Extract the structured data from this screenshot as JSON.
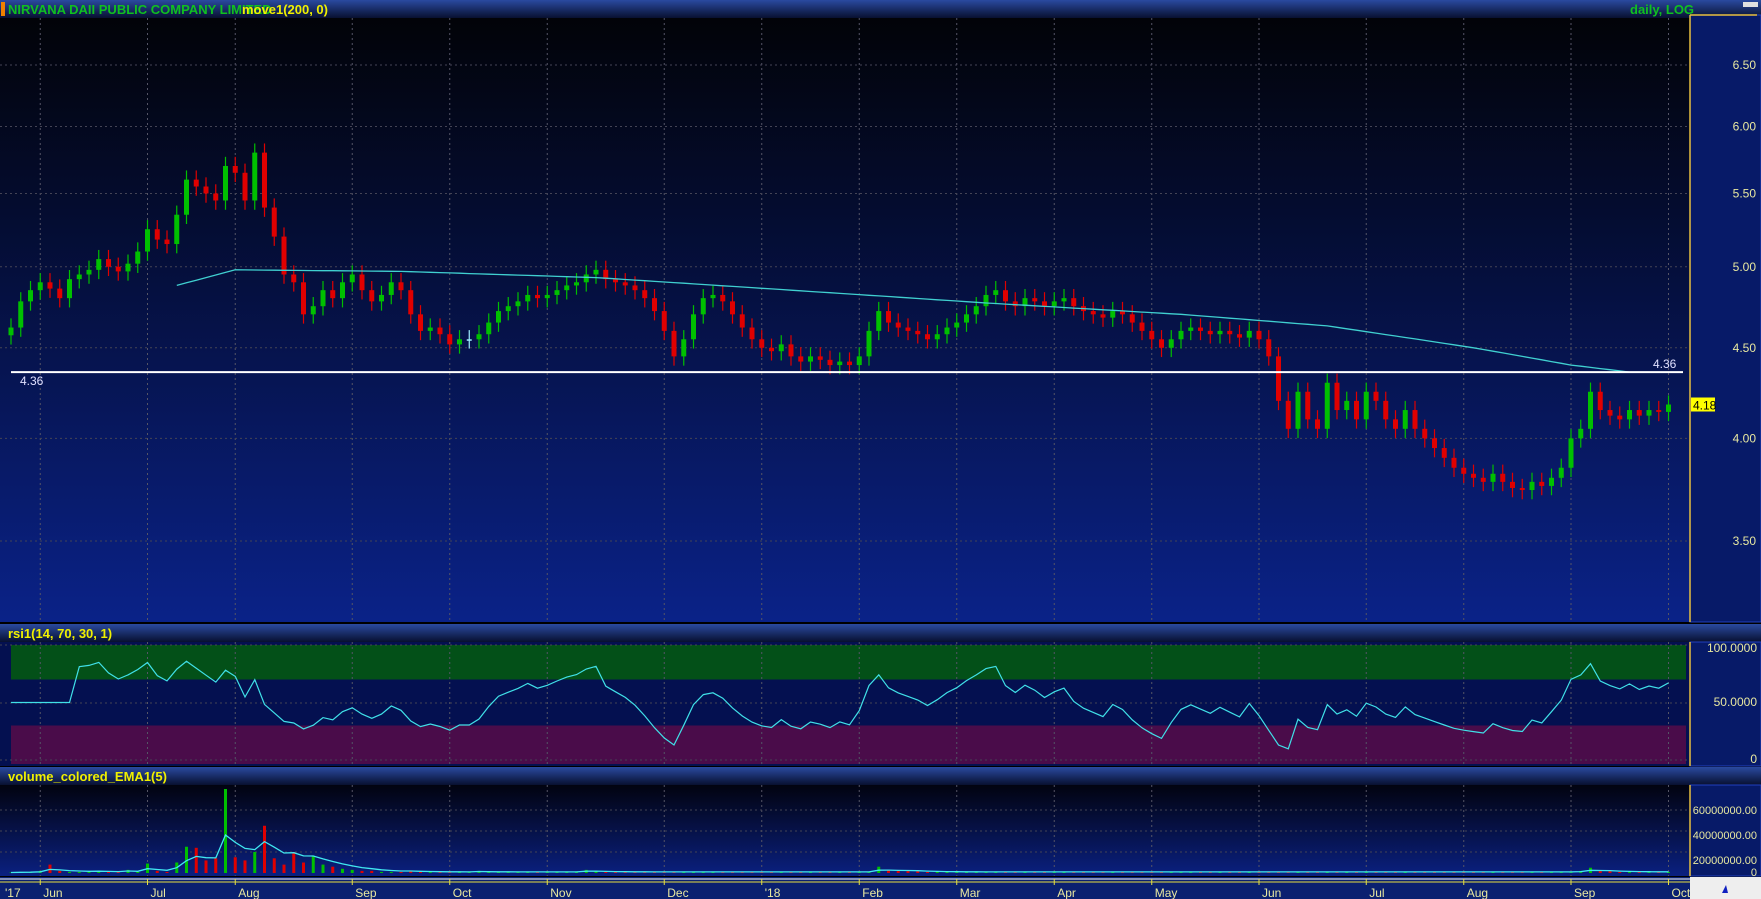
{
  "header": {
    "symbol_name": "NIRVANA DAII PUBLIC COMPANY LIMITED",
    "indicator": "move1(200, 0)",
    "interval": "daily, LOG"
  },
  "rsi_panel": {
    "title": "rsi1(14, 70, 30, 1)",
    "ticks": [
      "100.0000",
      "50.0000",
      "0"
    ],
    "overbought": 70,
    "oversold": 30
  },
  "volume_panel": {
    "title": "volume_colored_EMA1(5)",
    "ticks": [
      "60000000.00",
      "40000000.00",
      "20000000.00",
      "0"
    ],
    "ema_period": 5
  },
  "price_axis": {
    "ticks": [
      "6.50",
      "6.00",
      "5.50",
      "5.00",
      "4.50",
      "4.00",
      "3.50"
    ]
  },
  "hline": {
    "value": 4.36,
    "label_left": "4.36",
    "label_right": "4.36"
  },
  "last_price": "4.18",
  "colors": {
    "up": "#00c000",
    "down": "#e00000",
    "ma": "#40d0d0",
    "rsi": "#40e0e8",
    "accent": "#ffff00"
  },
  "chart_data": {
    "type": "candlestick",
    "scale": "log",
    "ylim": [
      3.2,
      6.8
    ],
    "x_labels": [
      {
        "label": "'17",
        "index": -1
      },
      {
        "label": "Jun",
        "index": 3
      },
      {
        "label": "Jul",
        "index": 14
      },
      {
        "label": "Aug",
        "index": 23
      },
      {
        "label": "Sep",
        "index": 35
      },
      {
        "label": "Oct",
        "index": 45
      },
      {
        "label": "Nov",
        "index": 55
      },
      {
        "label": "Dec",
        "index": 67
      },
      {
        "label": "'18",
        "index": 77
      },
      {
        "label": "Feb",
        "index": 87
      },
      {
        "label": "Mar",
        "index": 97
      },
      {
        "label": "Apr",
        "index": 107
      },
      {
        "label": "May",
        "index": 117
      },
      {
        "label": "Jun",
        "index": 128
      },
      {
        "label": "Jul",
        "index": 139
      },
      {
        "label": "Aug",
        "index": 149
      },
      {
        "label": "Sep",
        "index": 160
      },
      {
        "label": "Oct",
        "index": 170
      }
    ],
    "close": [
      4.62,
      4.78,
      4.85,
      4.9,
      4.86,
      4.8,
      4.92,
      4.95,
      4.98,
      5.05,
      5.0,
      4.97,
      5.02,
      5.1,
      5.25,
      5.18,
      5.15,
      5.35,
      5.6,
      5.55,
      5.5,
      5.45,
      5.7,
      5.65,
      5.45,
      5.8,
      5.4,
      5.2,
      4.95,
      4.9,
      4.7,
      4.75,
      4.85,
      4.8,
      4.9,
      4.95,
      4.85,
      4.78,
      4.82,
      4.9,
      4.85,
      4.7,
      4.6,
      4.62,
      4.58,
      4.52,
      4.55,
      4.55,
      4.58,
      4.65,
      4.72,
      4.75,
      4.78,
      4.82,
      4.8,
      4.82,
      4.85,
      4.88,
      4.9,
      4.95,
      4.98,
      4.92,
      4.9,
      4.88,
      4.85,
      4.8,
      4.72,
      4.6,
      4.45,
      4.55,
      4.7,
      4.8,
      4.82,
      4.78,
      4.7,
      4.62,
      4.55,
      4.5,
      4.48,
      4.52,
      4.45,
      4.42,
      4.45,
      4.43,
      4.4,
      4.42,
      4.4,
      4.45,
      4.6,
      4.72,
      4.65,
      4.62,
      4.6,
      4.58,
      4.55,
      4.58,
      4.62,
      4.65,
      4.7,
      4.75,
      4.82,
      4.85,
      4.78,
      4.75,
      4.8,
      4.78,
      4.75,
      4.78,
      4.8,
      4.75,
      4.72,
      4.7,
      4.68,
      4.72,
      4.7,
      4.65,
      4.6,
      4.55,
      4.5,
      4.55,
      4.6,
      4.62,
      4.6,
      4.58,
      4.6,
      4.58,
      4.56,
      4.6,
      4.55,
      4.45,
      4.2,
      4.05,
      4.25,
      4.1,
      4.05,
      4.3,
      4.15,
      4.2,
      4.1,
      4.25,
      4.2,
      4.1,
      4.05,
      4.15,
      4.05,
      4.0,
      3.95,
      3.9,
      3.85,
      3.82,
      3.8,
      3.78,
      3.82,
      3.78,
      3.75,
      3.74,
      3.78,
      3.76,
      3.8,
      3.85,
      4.0,
      4.05,
      4.25,
      4.15,
      4.12,
      4.1,
      4.15,
      4.12,
      4.15,
      4.14,
      4.18
    ],
    "volume_millions": [
      0.5,
      1,
      1,
      2,
      8,
      2,
      1,
      1,
      1,
      2,
      1,
      1,
      3,
      1,
      9,
      2,
      1,
      10,
      25,
      24,
      12,
      14,
      80,
      15,
      12,
      20,
      45,
      14,
      8,
      20,
      10,
      16,
      8,
      6,
      4,
      3,
      2,
      2,
      1,
      1,
      1,
      2,
      1,
      1,
      1,
      1,
      1,
      1,
      2,
      1,
      1,
      1,
      1,
      1,
      1,
      1,
      1,
      1,
      1,
      3,
      2,
      1,
      1,
      1,
      1,
      1,
      1,
      1,
      1,
      1,
      1,
      1,
      1,
      1,
      1,
      1,
      1,
      1,
      1,
      1,
      1,
      1,
      1,
      1,
      1,
      1,
      1,
      1,
      1,
      6,
      3,
      2,
      2,
      2,
      1,
      1,
      1,
      1,
      1,
      1,
      1,
      1,
      1,
      1,
      1,
      1,
      1,
      1,
      1,
      1,
      1,
      1,
      1,
      1,
      1,
      1,
      1,
      1,
      1,
      1,
      1,
      1,
      1,
      1,
      1,
      1,
      1,
      1,
      1,
      1,
      1,
      1,
      1,
      1,
      1,
      1,
      1,
      1,
      1,
      1,
      1,
      1,
      1,
      1,
      1,
      1,
      1,
      1,
      1,
      1,
      1,
      1,
      1,
      1,
      1,
      1,
      1,
      1,
      1,
      1,
      1,
      2,
      5,
      2,
      2,
      1,
      1,
      1,
      1,
      1,
      1
    ],
    "ma200": [
      [
        17,
        4.88
      ],
      [
        20,
        4.93
      ],
      [
        23,
        4.98
      ],
      [
        40,
        4.97
      ],
      [
        60,
        4.93
      ],
      [
        80,
        4.85
      ],
      [
        100,
        4.77
      ],
      [
        120,
        4.7
      ],
      [
        135,
        4.63
      ],
      [
        150,
        4.5
      ],
      [
        160,
        4.4
      ],
      [
        166,
        4.36
      ],
      [
        170,
        4.36
      ]
    ]
  }
}
